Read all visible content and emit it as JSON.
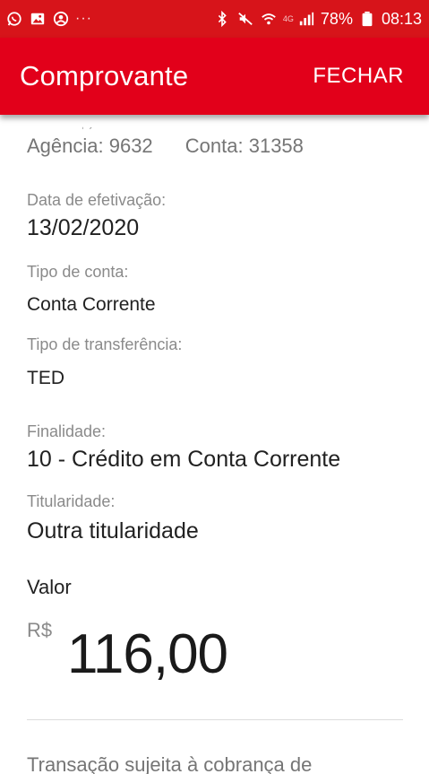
{
  "status_bar": {
    "icons": [
      "whatsapp-icon",
      "gallery-icon",
      "account-icon"
    ],
    "dots": "···",
    "right_icons": [
      "bluetooth-icon",
      "mute-icon",
      "wifi-icon",
      "signal-icon"
    ],
    "network_label": "4G",
    "battery_percent": "78%",
    "time": "08:13"
  },
  "app_bar": {
    "title": "Comprovante",
    "close_label": "FECHAR",
    "background": "#e2001a"
  },
  "account": {
    "agency": "Agência: 9632",
    "account": "Conta: 31358"
  },
  "fields": [
    {
      "label": "Data de efetivação:",
      "value": "13/02/2020"
    },
    {
      "label": "Tipo de conta:",
      "value": "Conta Corrente"
    },
    {
      "label": "Tipo de transferência:",
      "value": "TED"
    },
    {
      "label": "Finalidade:",
      "value": "10 - Crédito em Conta Corrente"
    },
    {
      "label": "Titularidade:",
      "value": "Outra titularidade"
    }
  ],
  "amount": {
    "label": "Valor",
    "currency": "R$",
    "value": "116,00"
  },
  "footnote": "Transação sujeita à cobrança de"
}
